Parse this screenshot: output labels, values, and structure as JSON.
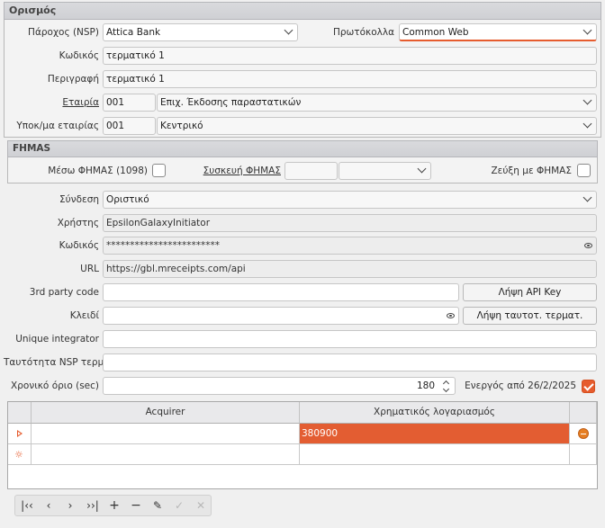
{
  "definition": {
    "section_title": "Ορισμός",
    "provider_label": "Πάροχος (NSP)",
    "provider_value": "Attica Bank",
    "protocols_label": "Πρωτόκολλα",
    "protocols_value": "Common Web",
    "code_label": "Κωδικός",
    "code_value": "τερματικό 1",
    "description_label": "Περιγραφή",
    "description_value": "τερματικό 1",
    "company_label": "Εταιρία",
    "company_code": "001",
    "company_name": "Επιχ. Έκδοσης παραστατικών",
    "branch_label": "Υποκ/μα εταιρίας",
    "branch_code": "001",
    "branch_name": "Κεντρικό"
  },
  "fhmas": {
    "section_title": "FHMAS",
    "means_label": "Μέσω ΦΗΜΑΣ (1098)",
    "means_checked": false,
    "device_label": "Συσκευή ΦΗΜΑΣ",
    "device_value": "",
    "pair_label": "Ζεύξη με ΦΗΜΑΣ",
    "pair_checked": false
  },
  "connection": {
    "connection_label": "Σύνδεση",
    "connection_value": "Οριστικό",
    "user_label": "Χρήστης",
    "user_value": "EpsilonGalaxyInitiator",
    "password_label": "Κωδικός",
    "password_value": "************************",
    "url_label": "URL",
    "url_value": "https://gbl.mreceipts.com/api",
    "third_party_label": "3rd party code",
    "third_party_value": "",
    "get_api_key_label": "Λήψη API Key",
    "key_label": "Κλειδί",
    "key_value": "",
    "get_terminal_id_label": "Λήψη ταυτοτ. τερματ.",
    "unique_integrator_label": "Unique integrator",
    "unique_integrator_value": "",
    "nsp_terminal_id_label": "Ταυτότητα NSP τερμ.",
    "nsp_terminal_id_value": "",
    "timeout_label": "Χρονικό όριο (sec)",
    "timeout_value": "180",
    "active_from_label": "Ενεργός από 26/2/2025",
    "active_checked": true
  },
  "table": {
    "columns": [
      "Acquirer",
      "Χρηματικός λογαριασμός"
    ],
    "rows": [
      {
        "acquirer": "",
        "account": "380900"
      }
    ]
  },
  "colors": {
    "accent": "#e65c2e",
    "selected_cell": "#e35d32"
  }
}
